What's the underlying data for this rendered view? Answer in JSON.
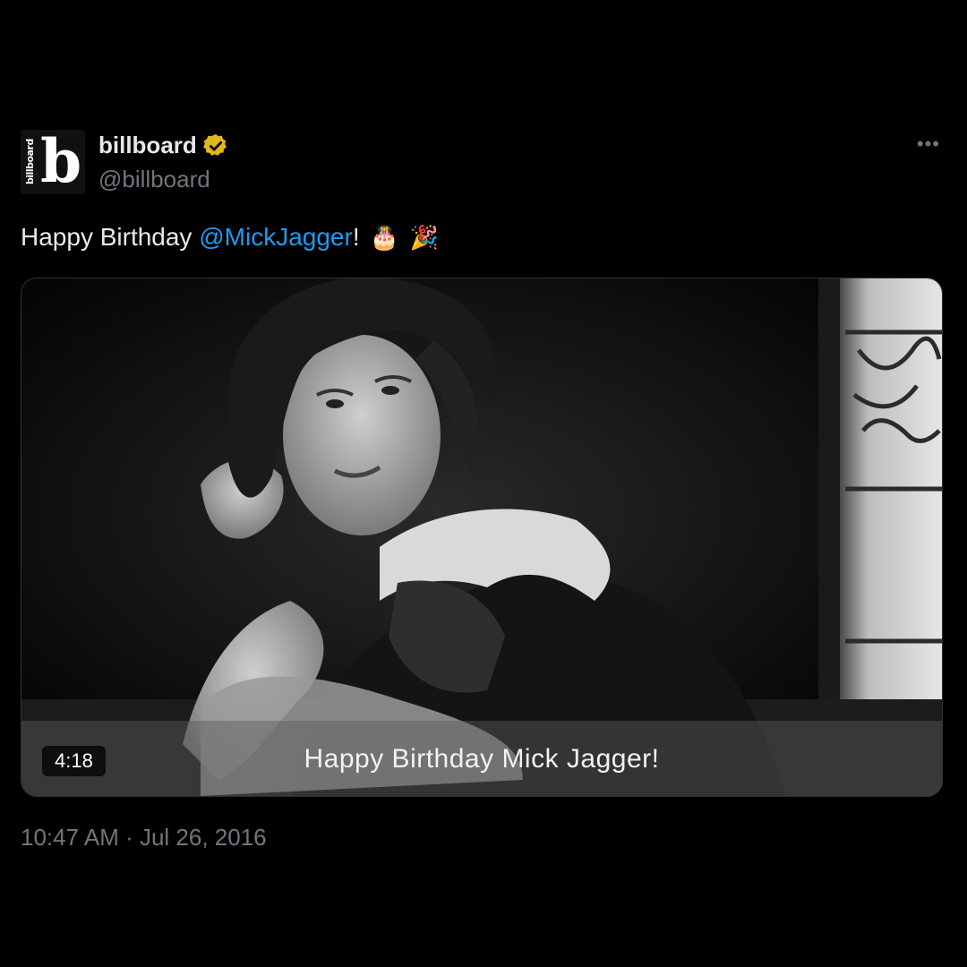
{
  "author": {
    "name": "billboard",
    "handle": "@billboard",
    "avatar_word": "billboard",
    "avatar_letter": "b",
    "verified_color": "#e2b719"
  },
  "more_label": "•••",
  "tweet": {
    "text_before": "Happy Birthday ",
    "mention": "@MickJagger",
    "text_after": "!",
    "emoji_1": "🎂",
    "emoji_2": "🎉"
  },
  "media": {
    "caption": "Happy Birthday Mick Jagger!",
    "duration": "4:18"
  },
  "timestamp": "10:47 AM · Jul 26, 2016",
  "colors": {
    "background": "#000000",
    "text": "#e7e9ea",
    "secondary": "#71767b",
    "link": "#1d9bf0"
  }
}
